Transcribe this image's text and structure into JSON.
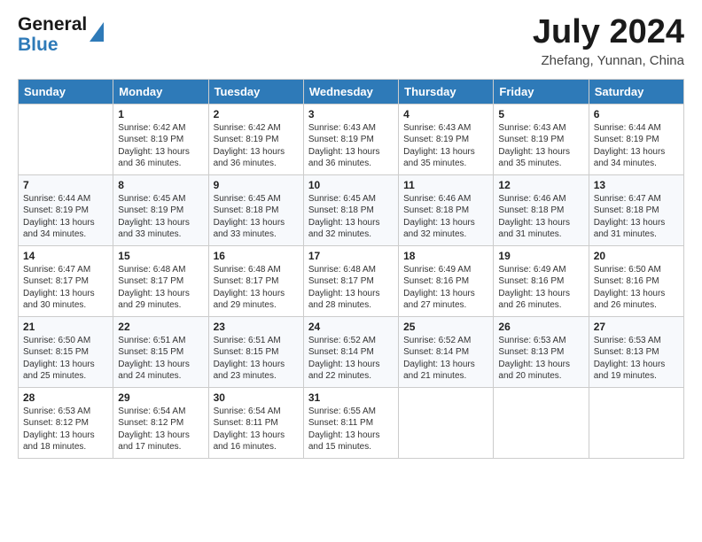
{
  "logo": {
    "general": "General",
    "blue": "Blue"
  },
  "header": {
    "month": "July 2024",
    "location": "Zhefang, Yunnan, China"
  },
  "days_of_week": [
    "Sunday",
    "Monday",
    "Tuesday",
    "Wednesday",
    "Thursday",
    "Friday",
    "Saturday"
  ],
  "weeks": [
    [
      {
        "day": "",
        "sunrise": "",
        "sunset": "",
        "daylight": ""
      },
      {
        "day": "1",
        "sunrise": "Sunrise: 6:42 AM",
        "sunset": "Sunset: 8:19 PM",
        "daylight": "Daylight: 13 hours and 36 minutes."
      },
      {
        "day": "2",
        "sunrise": "Sunrise: 6:42 AM",
        "sunset": "Sunset: 8:19 PM",
        "daylight": "Daylight: 13 hours and 36 minutes."
      },
      {
        "day": "3",
        "sunrise": "Sunrise: 6:43 AM",
        "sunset": "Sunset: 8:19 PM",
        "daylight": "Daylight: 13 hours and 36 minutes."
      },
      {
        "day": "4",
        "sunrise": "Sunrise: 6:43 AM",
        "sunset": "Sunset: 8:19 PM",
        "daylight": "Daylight: 13 hours and 35 minutes."
      },
      {
        "day": "5",
        "sunrise": "Sunrise: 6:43 AM",
        "sunset": "Sunset: 8:19 PM",
        "daylight": "Daylight: 13 hours and 35 minutes."
      },
      {
        "day": "6",
        "sunrise": "Sunrise: 6:44 AM",
        "sunset": "Sunset: 8:19 PM",
        "daylight": "Daylight: 13 hours and 34 minutes."
      }
    ],
    [
      {
        "day": "7",
        "sunrise": "Sunrise: 6:44 AM",
        "sunset": "Sunset: 8:19 PM",
        "daylight": "Daylight: 13 hours and 34 minutes."
      },
      {
        "day": "8",
        "sunrise": "Sunrise: 6:45 AM",
        "sunset": "Sunset: 8:19 PM",
        "daylight": "Daylight: 13 hours and 33 minutes."
      },
      {
        "day": "9",
        "sunrise": "Sunrise: 6:45 AM",
        "sunset": "Sunset: 8:18 PM",
        "daylight": "Daylight: 13 hours and 33 minutes."
      },
      {
        "day": "10",
        "sunrise": "Sunrise: 6:45 AM",
        "sunset": "Sunset: 8:18 PM",
        "daylight": "Daylight: 13 hours and 32 minutes."
      },
      {
        "day": "11",
        "sunrise": "Sunrise: 6:46 AM",
        "sunset": "Sunset: 8:18 PM",
        "daylight": "Daylight: 13 hours and 32 minutes."
      },
      {
        "day": "12",
        "sunrise": "Sunrise: 6:46 AM",
        "sunset": "Sunset: 8:18 PM",
        "daylight": "Daylight: 13 hours and 31 minutes."
      },
      {
        "day": "13",
        "sunrise": "Sunrise: 6:47 AM",
        "sunset": "Sunset: 8:18 PM",
        "daylight": "Daylight: 13 hours and 31 minutes."
      }
    ],
    [
      {
        "day": "14",
        "sunrise": "Sunrise: 6:47 AM",
        "sunset": "Sunset: 8:17 PM",
        "daylight": "Daylight: 13 hours and 30 minutes."
      },
      {
        "day": "15",
        "sunrise": "Sunrise: 6:48 AM",
        "sunset": "Sunset: 8:17 PM",
        "daylight": "Daylight: 13 hours and 29 minutes."
      },
      {
        "day": "16",
        "sunrise": "Sunrise: 6:48 AM",
        "sunset": "Sunset: 8:17 PM",
        "daylight": "Daylight: 13 hours and 29 minutes."
      },
      {
        "day": "17",
        "sunrise": "Sunrise: 6:48 AM",
        "sunset": "Sunset: 8:17 PM",
        "daylight": "Daylight: 13 hours and 28 minutes."
      },
      {
        "day": "18",
        "sunrise": "Sunrise: 6:49 AM",
        "sunset": "Sunset: 8:16 PM",
        "daylight": "Daylight: 13 hours and 27 minutes."
      },
      {
        "day": "19",
        "sunrise": "Sunrise: 6:49 AM",
        "sunset": "Sunset: 8:16 PM",
        "daylight": "Daylight: 13 hours and 26 minutes."
      },
      {
        "day": "20",
        "sunrise": "Sunrise: 6:50 AM",
        "sunset": "Sunset: 8:16 PM",
        "daylight": "Daylight: 13 hours and 26 minutes."
      }
    ],
    [
      {
        "day": "21",
        "sunrise": "Sunrise: 6:50 AM",
        "sunset": "Sunset: 8:15 PM",
        "daylight": "Daylight: 13 hours and 25 minutes."
      },
      {
        "day": "22",
        "sunrise": "Sunrise: 6:51 AM",
        "sunset": "Sunset: 8:15 PM",
        "daylight": "Daylight: 13 hours and 24 minutes."
      },
      {
        "day": "23",
        "sunrise": "Sunrise: 6:51 AM",
        "sunset": "Sunset: 8:15 PM",
        "daylight": "Daylight: 13 hours and 23 minutes."
      },
      {
        "day": "24",
        "sunrise": "Sunrise: 6:52 AM",
        "sunset": "Sunset: 8:14 PM",
        "daylight": "Daylight: 13 hours and 22 minutes."
      },
      {
        "day": "25",
        "sunrise": "Sunrise: 6:52 AM",
        "sunset": "Sunset: 8:14 PM",
        "daylight": "Daylight: 13 hours and 21 minutes."
      },
      {
        "day": "26",
        "sunrise": "Sunrise: 6:53 AM",
        "sunset": "Sunset: 8:13 PM",
        "daylight": "Daylight: 13 hours and 20 minutes."
      },
      {
        "day": "27",
        "sunrise": "Sunrise: 6:53 AM",
        "sunset": "Sunset: 8:13 PM",
        "daylight": "Daylight: 13 hours and 19 minutes."
      }
    ],
    [
      {
        "day": "28",
        "sunrise": "Sunrise: 6:53 AM",
        "sunset": "Sunset: 8:12 PM",
        "daylight": "Daylight: 13 hours and 18 minutes."
      },
      {
        "day": "29",
        "sunrise": "Sunrise: 6:54 AM",
        "sunset": "Sunset: 8:12 PM",
        "daylight": "Daylight: 13 hours and 17 minutes."
      },
      {
        "day": "30",
        "sunrise": "Sunrise: 6:54 AM",
        "sunset": "Sunset: 8:11 PM",
        "daylight": "Daylight: 13 hours and 16 minutes."
      },
      {
        "day": "31",
        "sunrise": "Sunrise: 6:55 AM",
        "sunset": "Sunset: 8:11 PM",
        "daylight": "Daylight: 13 hours and 15 minutes."
      },
      {
        "day": "",
        "sunrise": "",
        "sunset": "",
        "daylight": ""
      },
      {
        "day": "",
        "sunrise": "",
        "sunset": "",
        "daylight": ""
      },
      {
        "day": "",
        "sunrise": "",
        "sunset": "",
        "daylight": ""
      }
    ]
  ]
}
